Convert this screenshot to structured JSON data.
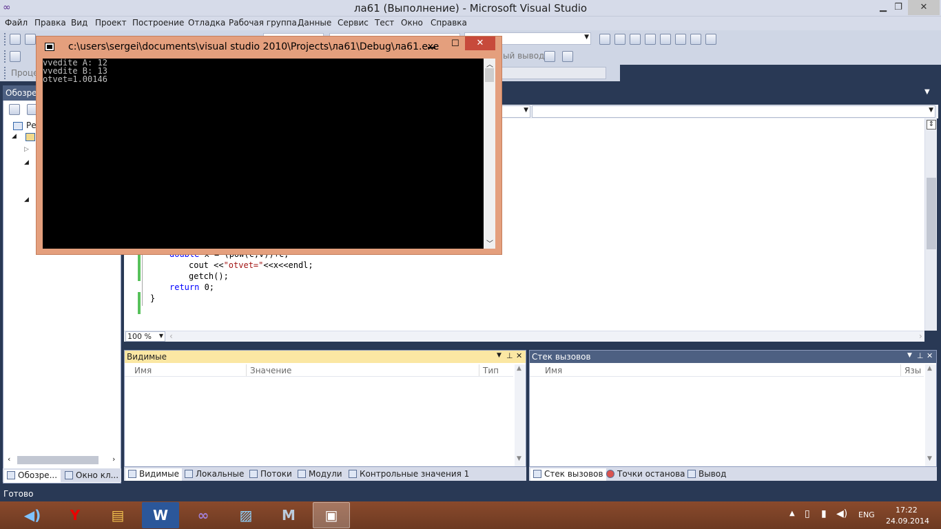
{
  "window": {
    "title": "ла61 (Выполнение) - Microsoft Visual Studio",
    "minimize": "▁",
    "restore": "❐",
    "close": "✕"
  },
  "menu": [
    "Файл",
    "Правка",
    "Вид",
    "Проект",
    "Построение",
    "Отладка",
    "Рабочая группа",
    "Данные",
    "Сервис",
    "Тест",
    "Окно",
    "Справка"
  ],
  "toolbar": {
    "output_label": "ый вывод",
    "process_label": "Проце"
  },
  "left_panel": {
    "title": "Обозре",
    "tree_item": "Ре",
    "tabs": [
      "Обозре...",
      "Окно кл..."
    ]
  },
  "editor": {
    "code": [
      "double x = (pow(c,v))+c;",
      "    cout <<\"otvet=\"<<x<<endl;",
      "    getch();",
      "return 0;",
      "}"
    ],
    "zoom": "100 %"
  },
  "watch": {
    "title": "Видимые",
    "columns": [
      "Имя",
      "Значение",
      "Тип"
    ],
    "tabs": [
      "Видимые",
      "Локальные",
      "Потоки",
      "Модули",
      "Контрольные значения 1"
    ]
  },
  "callstack": {
    "title": "Стек вызовов",
    "columns": [
      "Имя",
      "Язы"
    ],
    "tabs": [
      "Стек вызовов",
      "Точки останова",
      "Вывод"
    ]
  },
  "status": "Готово",
  "console": {
    "title": "c:\\users\\sergei\\documents\\visual studio 2010\\Projects\\ла61\\Debug\\ла61.exe",
    "lines": [
      "vvedite A: 12",
      "vvedite B: 13",
      "otvet=1.00146"
    ]
  },
  "taskbar": {
    "lang": "ENG",
    "time": "17:22",
    "date": "24.09.2014",
    "apps": [
      "speaker-icon",
      "yandex-browser-icon",
      "file-explorer-icon",
      "word-icon",
      "visual-studio-icon",
      "photo-viewer-icon",
      "matlab-icon",
      "console-app-icon"
    ]
  }
}
